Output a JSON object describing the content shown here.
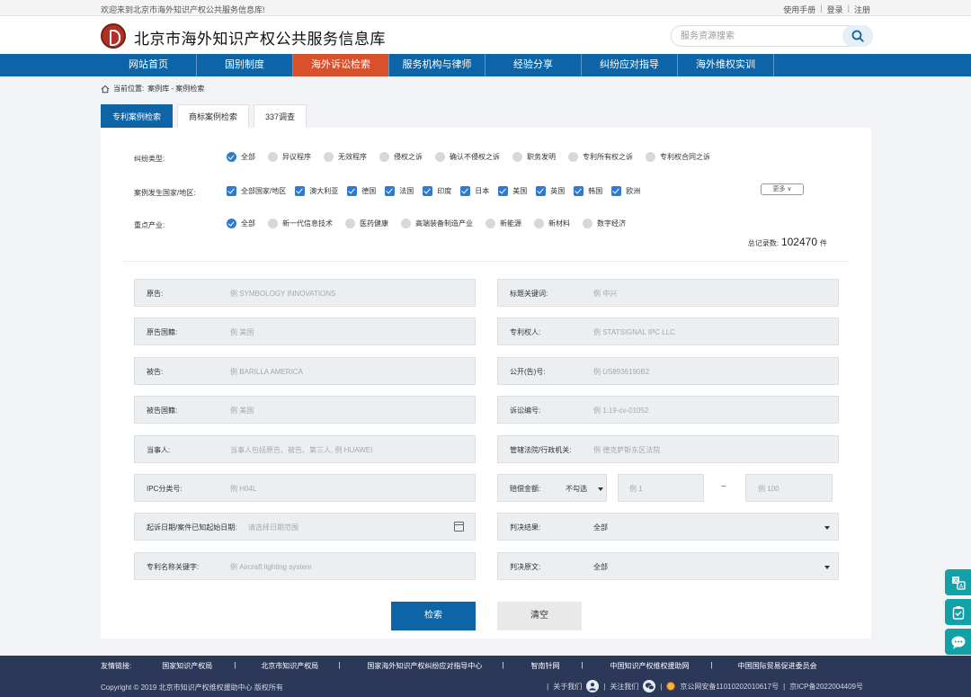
{
  "topbar": {
    "welcome": "欢迎来到北京市海外知识产权公共服务信息库!",
    "manual": "使用手册",
    "login": "登录",
    "register": "注册",
    "sep": "|"
  },
  "header": {
    "title": "北京市海外知识产权公共服务信息库",
    "search_placeholder": "服务资源搜索"
  },
  "nav": {
    "items": [
      {
        "label": "网站首页"
      },
      {
        "label": "国别制度"
      },
      {
        "label": "海外诉讼检索",
        "active": true
      },
      {
        "label": "服务机构与律师"
      },
      {
        "label": "经验分享"
      },
      {
        "label": "纠纷应对指导"
      },
      {
        "label": "海外维权实训"
      }
    ]
  },
  "breadcrumb": {
    "prefix": "当前位置:",
    "path": "案例库 - 案例检索"
  },
  "tabs": [
    {
      "label": "专利案例检索",
      "active": true
    },
    {
      "label": "商标案例检索"
    },
    {
      "label": "337调查"
    }
  ],
  "filters": {
    "dispute_type": {
      "label": "纠纷类型:",
      "options": [
        {
          "label": "全部",
          "checked": true
        },
        {
          "label": "异议程序"
        },
        {
          "label": "无效程序"
        },
        {
          "label": "侵权之诉"
        },
        {
          "label": "确认不侵权之诉"
        },
        {
          "label": "职务发明"
        },
        {
          "label": "专利所有权之诉"
        },
        {
          "label": "专利权合同之诉"
        }
      ]
    },
    "country": {
      "label": "案例发生国家/地区:",
      "options": [
        {
          "label": "全部国家/地区",
          "checked": true
        },
        {
          "label": "澳大利亚",
          "checked": true
        },
        {
          "label": "德国",
          "checked": true
        },
        {
          "label": "法国",
          "checked": true
        },
        {
          "label": "印度",
          "checked": true
        },
        {
          "label": "日本",
          "checked": true
        },
        {
          "label": "美国",
          "checked": true
        },
        {
          "label": "英国",
          "checked": true
        },
        {
          "label": "韩国",
          "checked": true
        },
        {
          "label": "欧洲",
          "checked": true
        }
      ],
      "more": "更多 ∨"
    },
    "industry": {
      "label": "重点产业:",
      "options": [
        {
          "label": "全部",
          "checked": true
        },
        {
          "label": "新一代信息技术"
        },
        {
          "label": "医药健康"
        },
        {
          "label": "高端装备制造产业"
        },
        {
          "label": "新能源"
        },
        {
          "label": "新材料"
        },
        {
          "label": "数字经济"
        }
      ]
    }
  },
  "total": {
    "label": "总记录数:",
    "count": "102470",
    "unit": "件"
  },
  "form": {
    "plaintiff": {
      "label": "原告:",
      "placeholder": "例 SYMBOLOGY INNOVATIONS"
    },
    "plaintiff_nationality": {
      "label": "原告国籍:",
      "placeholder": "例 美国"
    },
    "defendant": {
      "label": "被告:",
      "placeholder": "例 BARILLA AMERICA"
    },
    "defendant_nationality": {
      "label": "被告国籍:",
      "placeholder": "例 美国"
    },
    "party": {
      "label": "当事人:",
      "placeholder": "当事人包括原告、被告、第三人, 例 HUAWEI"
    },
    "ipc": {
      "label": "IPC分类号:",
      "placeholder": "例 H04L"
    },
    "date": {
      "label": "起诉日期/案件已知起始日期:",
      "placeholder": "请选择日期范围"
    },
    "patent_keyword": {
      "label": "专利名称关键字:",
      "placeholder": "例 Aircraft lighting system"
    },
    "title_keyword": {
      "label": "标题关键词:",
      "placeholder": "例 中兴"
    },
    "patentee": {
      "label": "专利权人:",
      "placeholder": "例 STATSIGNAL IPC LLC"
    },
    "pub_number": {
      "label": "公开(告)号:",
      "placeholder": "例 US8936190B2"
    },
    "case_number": {
      "label": "诉讼编号:",
      "placeholder": "例 1:19-cv-01052"
    },
    "court": {
      "label": "管辖法院/行政机关:",
      "placeholder": "例 德克萨斯东区法院"
    },
    "compensation": {
      "label": "赔偿金额:",
      "select": "不勾选",
      "min_placeholder": "例 1",
      "tilde": "~",
      "max_placeholder": "例 100"
    },
    "result": {
      "label": "判决结果:",
      "value": "全部"
    },
    "judgment_text": {
      "label": "判决原文:",
      "value": "全部"
    }
  },
  "buttons": {
    "search": "检索",
    "clear": "清空"
  },
  "footer": {
    "friends_label": "友情链接:",
    "links": [
      "国家知识产权局",
      "北京市知识产权局",
      "国家海外知识产权纠纷应对指导中心",
      "智南针网",
      "中国知识产权维权援助网",
      "中国国际贸易促进委员会"
    ],
    "sep": "|",
    "copyright": "Copyright © 2019 北京市知识产权维权援助中心 版权所有",
    "about": "关于我们",
    "follow": "关注我们",
    "police": "京公网安备11010202010617号",
    "icp": "京ICP备2022004409号"
  },
  "colors": {
    "primary": "#0d64a6",
    "nav_active": "#d9502c",
    "footer": "#2b3858",
    "float": "#13a1a8"
  },
  "icons": [
    "home-icon",
    "search-icon",
    "calendar-icon",
    "translate-icon",
    "clipboard-icon",
    "chat-icon",
    "user-icon",
    "wechat-icon",
    "police-badge-icon"
  ]
}
